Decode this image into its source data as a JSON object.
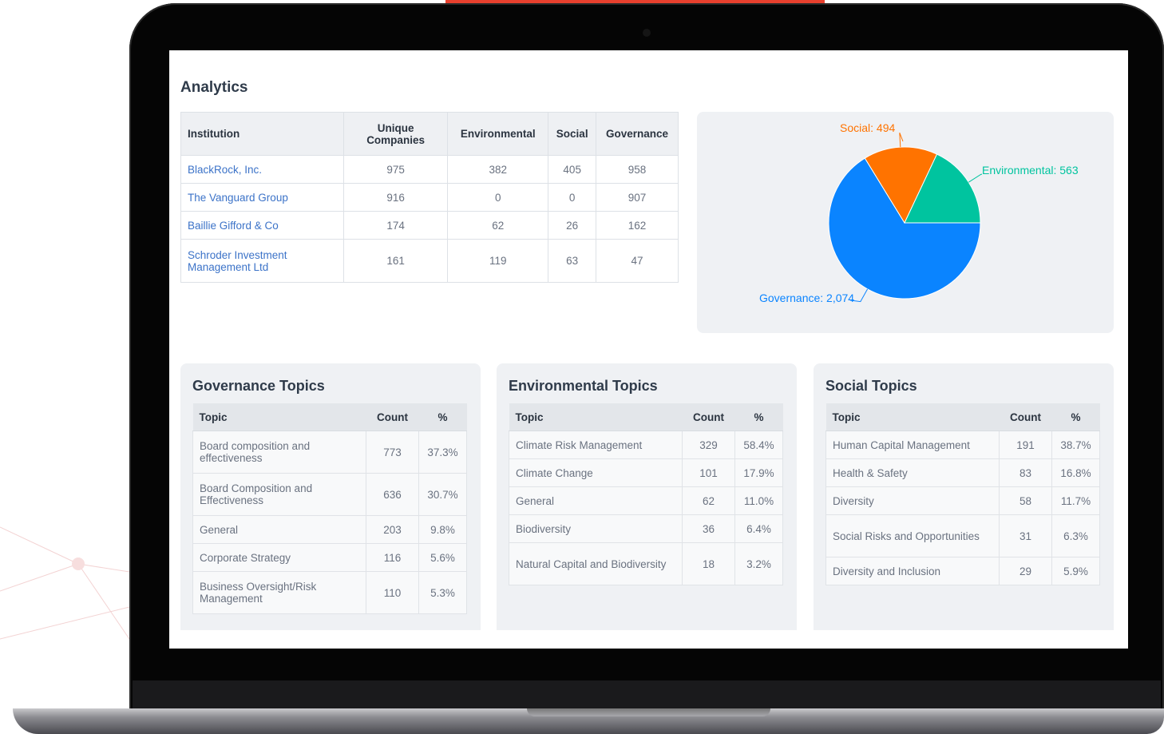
{
  "page": {
    "title": "Analytics",
    "accent_color": "#e8402e",
    "link_color": "#3c73c8"
  },
  "institutions": {
    "headers": [
      "Institution",
      "Unique Companies",
      "Environmental",
      "Social",
      "Governance"
    ],
    "rows": [
      {
        "name": "BlackRock, Inc.",
        "unique": "975",
        "environmental": "382",
        "social": "405",
        "governance": "958"
      },
      {
        "name": "The Vanguard Group",
        "unique": "916",
        "environmental": "0",
        "social": "0",
        "governance": "907"
      },
      {
        "name": "Baillie Gifford & Co",
        "unique": "174",
        "environmental": "62",
        "social": "26",
        "governance": "162"
      },
      {
        "name": "Schroder Investment Management Ltd",
        "unique": "161",
        "environmental": "119",
        "social": "63",
        "governance": "47"
      }
    ]
  },
  "chart_data": {
    "type": "pie",
    "slices": [
      {
        "label": "Governance",
        "value": 2074,
        "display": "Governance: 2,074",
        "color": "#0a84ff"
      },
      {
        "label": "Social",
        "value": 494,
        "display": "Social: 494",
        "color": "#ff7300"
      },
      {
        "label": "Environmental",
        "value": 563,
        "display": "Environmental: 563",
        "color": "#00c49f"
      }
    ]
  },
  "governance_topics": {
    "title": "Governance Topics",
    "headers": [
      "Topic",
      "Count",
      "%"
    ],
    "rows": [
      {
        "topic": "Board composition and effectiveness",
        "count": "773",
        "pct": "37.3%"
      },
      {
        "topic": "Board Composition and Effectiveness",
        "count": "636",
        "pct": "30.7%"
      },
      {
        "topic": "General",
        "count": "203",
        "pct": "9.8%"
      },
      {
        "topic": "Corporate Strategy",
        "count": "116",
        "pct": "5.6%"
      },
      {
        "topic": "Business Oversight/Risk Management",
        "count": "110",
        "pct": "5.3%"
      }
    ]
  },
  "environmental_topics": {
    "title": "Environmental Topics",
    "headers": [
      "Topic",
      "Count",
      "%"
    ],
    "rows": [
      {
        "topic": "Climate Risk Management",
        "count": "329",
        "pct": "58.4%"
      },
      {
        "topic": "Climate Change",
        "count": "101",
        "pct": "17.9%"
      },
      {
        "topic": "General",
        "count": "62",
        "pct": "11.0%"
      },
      {
        "topic": "Biodiversity",
        "count": "36",
        "pct": "6.4%"
      },
      {
        "topic": "Natural Capital and Biodiversity",
        "count": "18",
        "pct": "3.2%"
      }
    ]
  },
  "social_topics": {
    "title": "Social Topics",
    "headers": [
      "Topic",
      "Count",
      "%"
    ],
    "rows": [
      {
        "topic": "Human Capital Management",
        "count": "191",
        "pct": "38.7%"
      },
      {
        "topic": "Health & Safety",
        "count": "83",
        "pct": "16.8%"
      },
      {
        "topic": "Diversity",
        "count": "58",
        "pct": "11.7%"
      },
      {
        "topic": "Social Risks and Opportunities",
        "count": "31",
        "pct": "6.3%"
      },
      {
        "topic": "Diversity and Inclusion",
        "count": "29",
        "pct": "5.9%"
      }
    ]
  }
}
